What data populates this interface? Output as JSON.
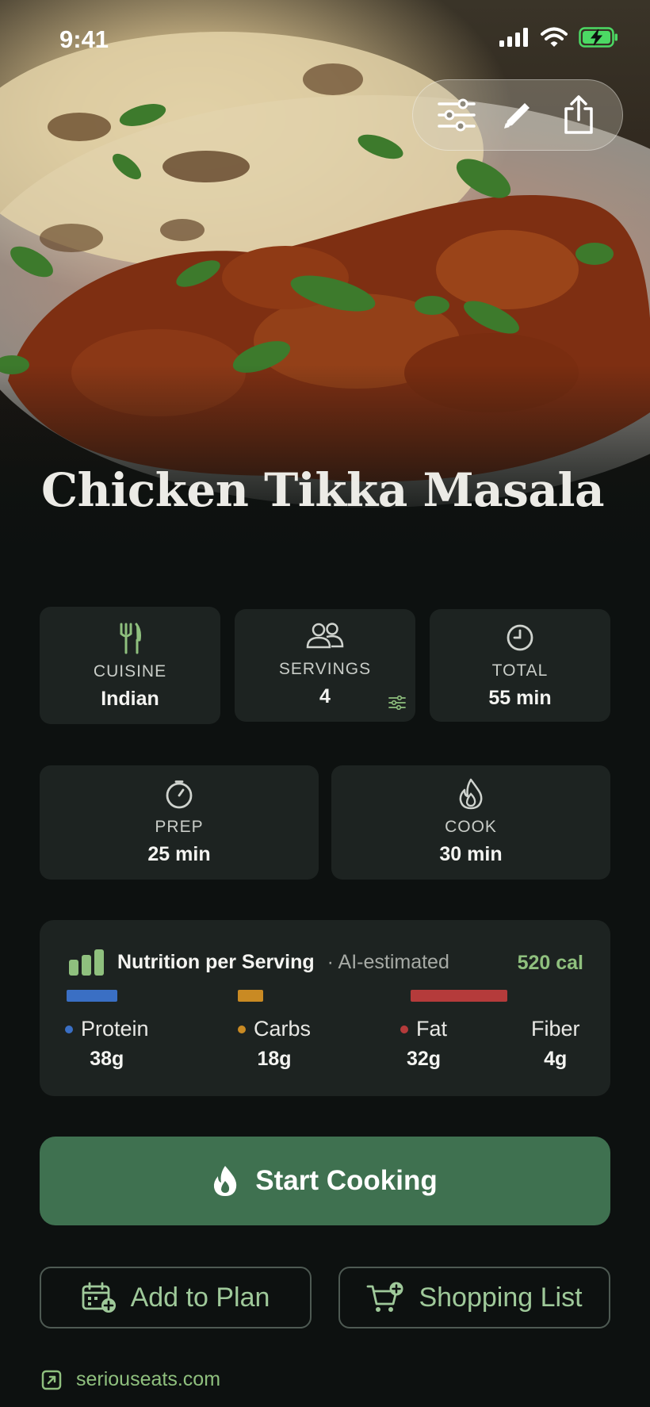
{
  "status": {
    "time": "9:41"
  },
  "recipe": {
    "title": "Chicken Tikka Masala"
  },
  "hero_actions": [
    {
      "icon": "sliders-icon"
    },
    {
      "icon": "pencil-icon"
    },
    {
      "icon": "share-icon"
    }
  ],
  "info": {
    "cuisine": {
      "label": "CUISINE",
      "value": "Indian",
      "icon": "fork-knife-icon"
    },
    "servings": {
      "label": "SERVINGS",
      "value": "4",
      "icon": "people-icon"
    },
    "total": {
      "label": "TOTAL",
      "value": "55 min",
      "icon": "clock-icon"
    },
    "prep": {
      "label": "PREP",
      "value": "25 min",
      "icon": "timer-icon"
    },
    "cook": {
      "label": "COOK",
      "value": "30 min",
      "icon": "flame-icon"
    }
  },
  "nutrition": {
    "title": "Nutrition per Serving",
    "note": "· AI-estimated",
    "calories": "520 cal",
    "macros": [
      {
        "name": "Protein",
        "amount": "38g",
        "color": "#3a6fc4"
      },
      {
        "name": "Carbs",
        "amount": "18g",
        "color": "#c98a23"
      },
      {
        "name": "Fat",
        "amount": "32g",
        "color": "#b53b3b"
      },
      {
        "name": "Fiber",
        "amount": "4g",
        "color": ""
      }
    ]
  },
  "actions": {
    "start": "Start Cooking",
    "add_to_plan": "Add to Plan",
    "shopping_list": "Shopping List"
  },
  "source": "seriouseats.com",
  "colors": {
    "accent": "#3f7150",
    "accent_text": "#8fc07e",
    "card": "#1d2321",
    "background": "#0d1110"
  }
}
